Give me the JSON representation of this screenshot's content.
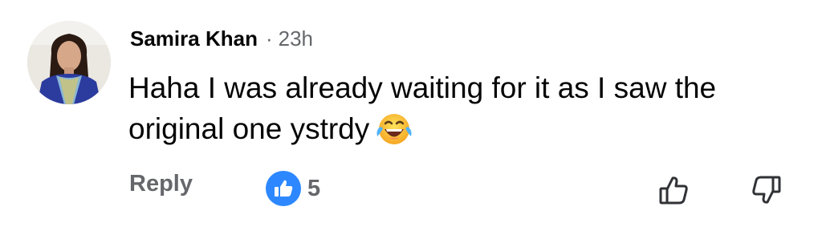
{
  "comment": {
    "author": "Samira Khan",
    "separator": "·",
    "timestamp": "23h",
    "text": "Haha I was already waiting for it as I saw the original one ystrdy",
    "emoji": "face-with-tears-of-joy"
  },
  "actions": {
    "reply_label": "Reply",
    "reaction_type": "like",
    "reaction_count": "5"
  },
  "colors": {
    "like_blue": "#2d88ff",
    "secondary_text": "#65676b",
    "primary_text": "#050505"
  },
  "icons": {
    "upvote": "thumbs-up-outline-icon",
    "downvote": "thumbs-down-outline-icon"
  }
}
